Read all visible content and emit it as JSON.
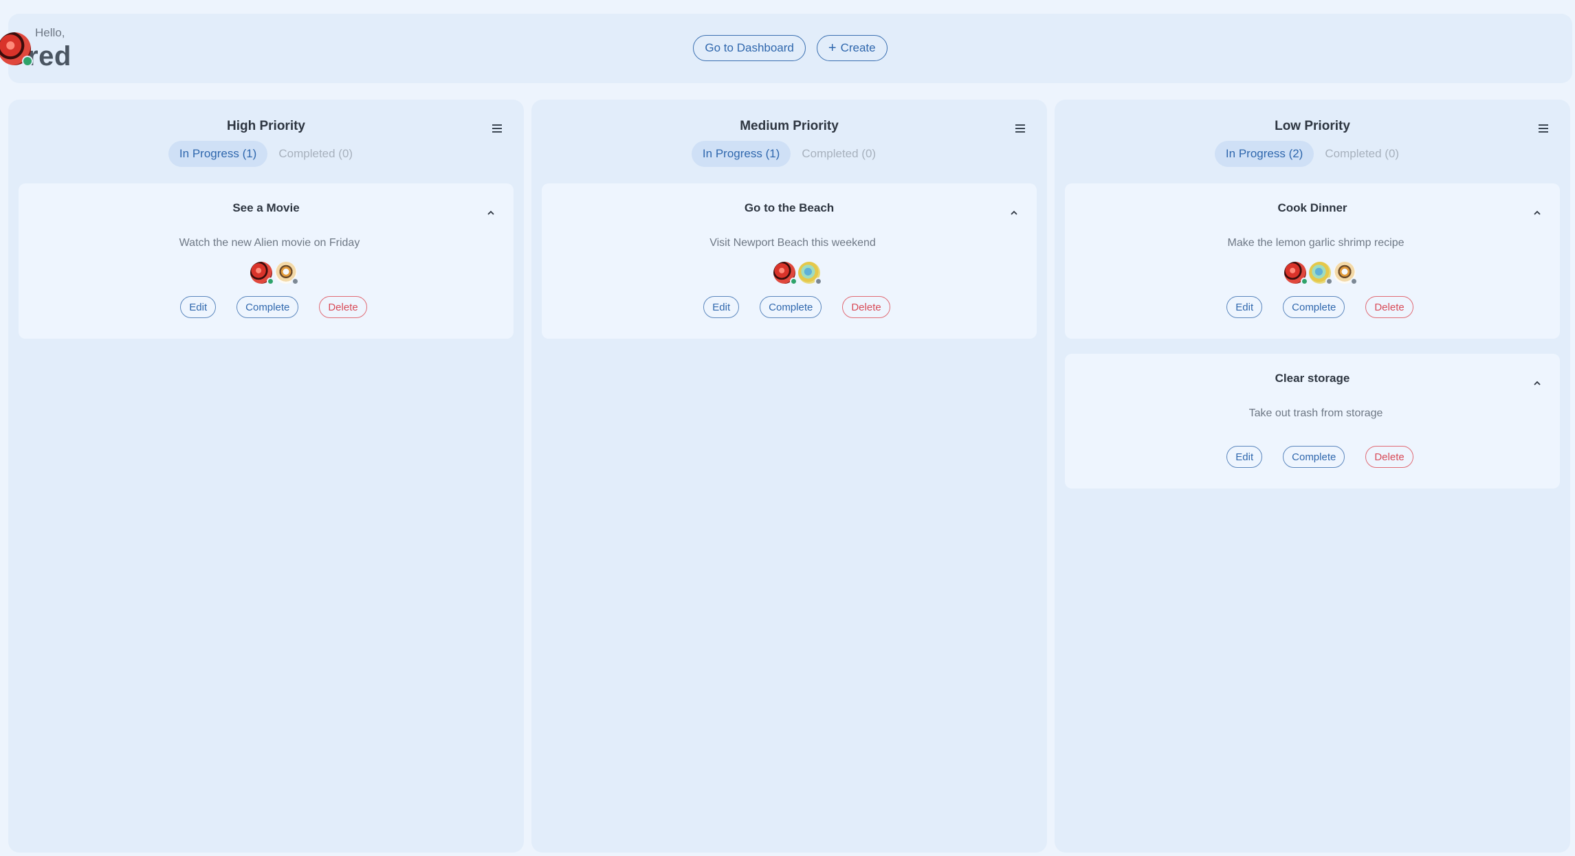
{
  "header": {
    "greeting": "Hello,",
    "username": "red",
    "dashboard_label": "Go to Dashboard",
    "create_label": "Create"
  },
  "columns": [
    {
      "title": "High Priority",
      "tab_in_progress": "In Progress (1)",
      "tab_completed": "Completed (0)",
      "tasks": [
        {
          "title": "See a Movie",
          "description": "Watch the new Alien movie on Friday",
          "edit": "Edit",
          "complete": "Complete",
          "delete": "Delete"
        }
      ]
    },
    {
      "title": "Medium Priority",
      "tab_in_progress": "In Progress (1)",
      "tab_completed": "Completed (0)",
      "tasks": [
        {
          "title": "Go to the Beach",
          "description": "Visit Newport Beach this weekend",
          "edit": "Edit",
          "complete": "Complete",
          "delete": "Delete"
        }
      ]
    },
    {
      "title": "Low Priority",
      "tab_in_progress": "In Progress (2)",
      "tab_completed": "Completed (0)",
      "tasks": [
        {
          "title": "Cook Dinner",
          "description": "Make the lemon garlic shrimp recipe",
          "edit": "Edit",
          "complete": "Complete",
          "delete": "Delete"
        },
        {
          "title": "Clear storage",
          "description": "Take out trash from storage",
          "edit": "Edit",
          "complete": "Complete",
          "delete": "Delete"
        }
      ]
    }
  ],
  "colors": {
    "background": "#edf4fd",
    "panel": "#e2edfa",
    "card": "#eef5fe",
    "accent": "#2f67ad",
    "danger": "#d84a57",
    "online": "#2ea36a",
    "offline": "#7c8894"
  }
}
